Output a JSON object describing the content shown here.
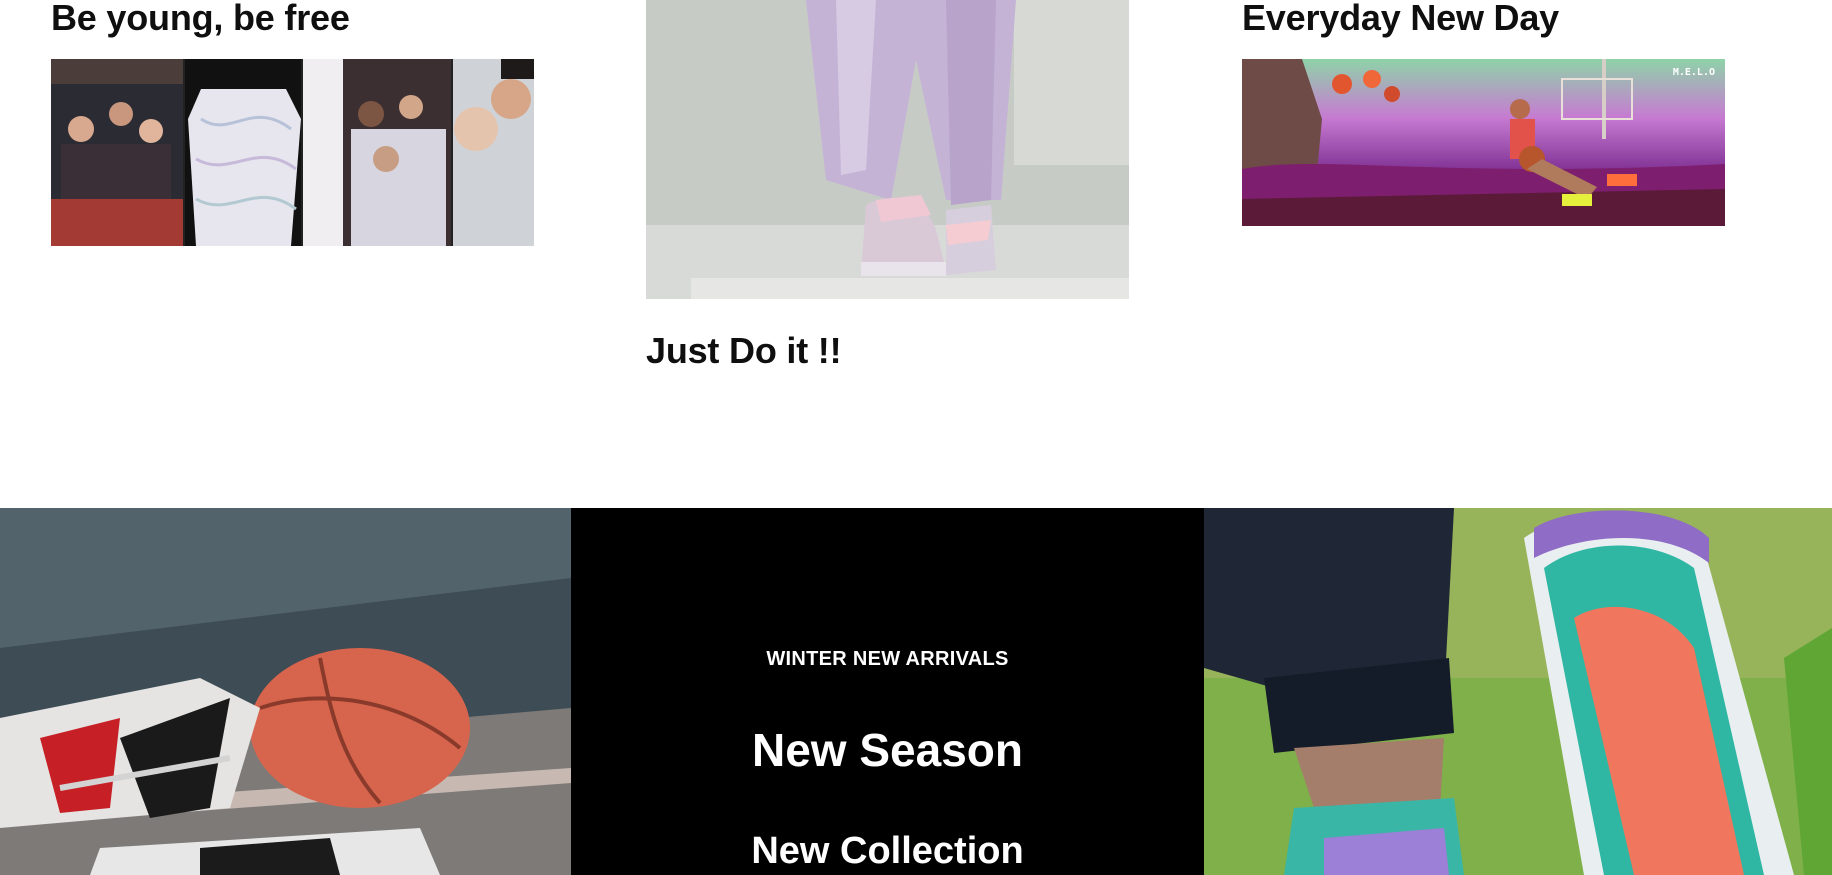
{
  "columns": [
    {
      "title": "Be young, be free",
      "image_alt": "Liverpool kit collage photo"
    },
    {
      "title": "Just Do it !!",
      "image_alt": "Lavender trousers and pastel sneakers photo"
    },
    {
      "title": "Everyday New Day",
      "image_alt": "Basketball player in colorful fantasy scene",
      "image_badge": "M.E.L.O"
    }
  ],
  "banner": {
    "eyebrow": "WINTER NEW ARRIVALS",
    "headline": "New Season",
    "subhead": "New Collection",
    "left_image_alt": "Sneaker beside basketball on court",
    "right_image_alt": "Runner wearing purple and teal sneaker on grass"
  }
}
